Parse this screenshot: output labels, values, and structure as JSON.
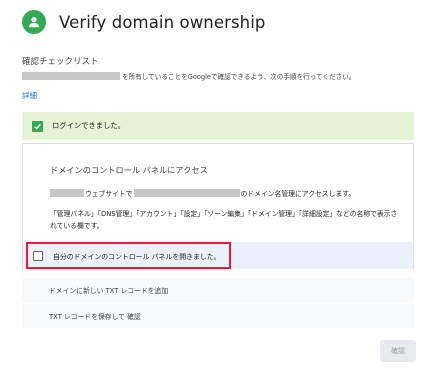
{
  "header": {
    "title": "Verify domain ownership",
    "icon": "person-icon",
    "accent": "#34a853"
  },
  "checklist": {
    "title": "確認チェックリスト",
    "description": "を所有していることをGoogleで確認できるよう、次の手順を行ってください。",
    "details_link": "詳細"
  },
  "login_banner": {
    "text": "ログインできました。",
    "checked": true
  },
  "step_card": {
    "title": "ドメインのコントロール パネルにアクセス",
    "line_mid": "ウェブサイトで",
    "line_end": "のドメイン名管理にアクセスします。",
    "note": "「管理パネル」「DNS管理」「アカウント」「設定」「ゾーン編集」「ドメイン管理」「詳細設定」などの名称で表示されている欄です。",
    "confirm_label": "自分のドメインのコントロール パネルを開きました。",
    "confirm_checked": false
  },
  "steps": [
    {
      "label": "ドメインに新しい TXT レコードを追加"
    },
    {
      "label": "TXT レコードを保存して 確認"
    }
  ],
  "buttons": {
    "confirm": "確認"
  },
  "colors": {
    "banner_bg": "#e6f4d6",
    "highlight_border": "#e8193b",
    "link": "#1a73e8"
  }
}
